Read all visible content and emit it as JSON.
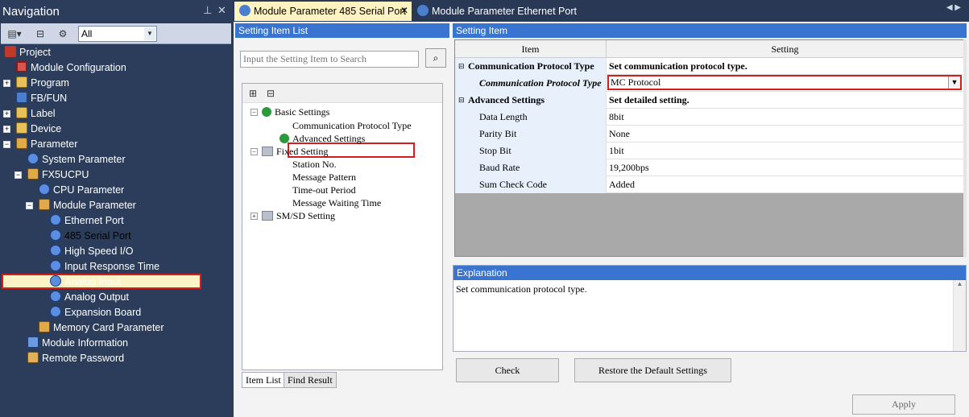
{
  "navigation": {
    "title": "Navigation",
    "filter_value": "All",
    "tree": [
      {
        "label": "Project",
        "icon": "project-icon"
      },
      {
        "label": "Module Configuration",
        "icon": "module-config-icon"
      },
      {
        "label": "Program",
        "icon": "program-icon"
      },
      {
        "label": "FB/FUN",
        "icon": "fbfun-icon"
      },
      {
        "label": "Label",
        "icon": "label-icon"
      },
      {
        "label": "Device",
        "icon": "device-icon"
      },
      {
        "label": "Parameter",
        "icon": "parameter-icon"
      },
      {
        "label": "System Parameter",
        "icon": "gear-icon"
      },
      {
        "label": "FX5UCPU",
        "icon": "cpu-icon"
      },
      {
        "label": "CPU Parameter",
        "icon": "gear-icon"
      },
      {
        "label": "Module Parameter",
        "icon": "gear-icon"
      },
      {
        "label": "Ethernet Port",
        "icon": "gear-icon"
      },
      {
        "label": "485 Serial Port",
        "icon": "gear-icon"
      },
      {
        "label": "High Speed I/O",
        "icon": "gear-icon"
      },
      {
        "label": "Input Response Time",
        "icon": "gear-icon"
      },
      {
        "label": "Analog Input",
        "icon": "gear-icon"
      },
      {
        "label": "Analog Output",
        "icon": "gear-icon"
      },
      {
        "label": "Expansion Board",
        "icon": "gear-icon"
      },
      {
        "label": "Memory Card Parameter",
        "icon": "memory-card-icon"
      },
      {
        "label": "Module Information",
        "icon": "info-icon"
      },
      {
        "label": "Remote Password",
        "icon": "lock-icon"
      }
    ]
  },
  "tabs": {
    "active": "Module Parameter 485 Serial Port",
    "other": "Module Parameter Ethernet Port"
  },
  "setting_item_list": {
    "header": "Setting Item List",
    "search_placeholder": "Input the Setting Item to Search",
    "items": {
      "basic": "Basic Settings",
      "cpt": "Communication Protocol Type",
      "advanced": "Advanced Settings",
      "fixed": "Fixed Setting",
      "station": "Station No.",
      "message_pattern": "Message Pattern",
      "timeout": "Time-out Period",
      "waiting": "Message Waiting Time",
      "smsd": "SM/SD Setting"
    },
    "bottom_tabs": [
      "Item List",
      "Find Result"
    ]
  },
  "setting_item": {
    "header": "Setting Item",
    "col_item": "Item",
    "col_setting": "Setting",
    "rows": [
      {
        "item": "Communication Protocol Type",
        "setting": "Set communication protocol type."
      },
      {
        "item": "Communication Protocol Type",
        "setting": "MC Protocol"
      },
      {
        "item": "Advanced Settings",
        "setting": "Set detailed setting."
      },
      {
        "item": "Data Length",
        "setting": "8bit"
      },
      {
        "item": "Parity Bit",
        "setting": "None"
      },
      {
        "item": "Stop Bit",
        "setting": "1bit"
      },
      {
        "item": "Baud Rate",
        "setting": "19,200bps"
      },
      {
        "item": "Sum Check Code",
        "setting": "Added"
      }
    ]
  },
  "explanation": {
    "header": "Explanation",
    "text": "Set communication protocol type."
  },
  "buttons": {
    "check": "Check",
    "restore": "Restore the Default Settings",
    "apply": "Apply"
  }
}
